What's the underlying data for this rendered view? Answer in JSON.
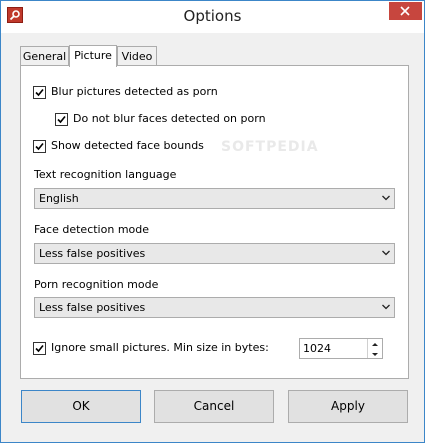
{
  "window": {
    "title": "Options"
  },
  "tabs": [
    {
      "label": "General"
    },
    {
      "label": "Picture"
    },
    {
      "label": "Video"
    }
  ],
  "picture": {
    "blur_porn": {
      "label": "Blur pictures detected as porn",
      "checked": true
    },
    "no_blur_faces": {
      "label": "Do not blur faces detected on porn",
      "checked": true
    },
    "show_face_bounds": {
      "label": "Show detected face bounds",
      "checked": true
    },
    "text_lang": {
      "label": "Text recognition language",
      "value": "English"
    },
    "face_mode": {
      "label": "Face detection mode",
      "value": "Less false positives"
    },
    "porn_mode": {
      "label": "Porn recognition mode",
      "value": "Less false positives"
    },
    "small_pics": {
      "label": "Ignore small pictures. Min size in bytes:",
      "checked": true,
      "value": "1024"
    }
  },
  "buttons": {
    "ok": "OK",
    "cancel": "Cancel",
    "apply": "Apply"
  },
  "watermark": "SOFTPEDIA",
  "colors": {
    "accent": "#3c86c8",
    "close": "#c7463e"
  }
}
